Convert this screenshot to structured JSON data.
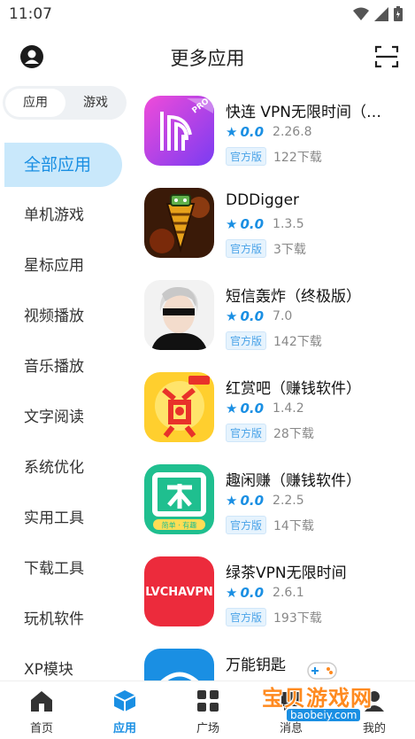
{
  "status": {
    "time": "11:07"
  },
  "header": {
    "title": "更多应用"
  },
  "segment": {
    "apps": "应用",
    "games": "游戏"
  },
  "sidebar": {
    "items": [
      {
        "label": "全部应用",
        "active": true
      },
      {
        "label": "单机游戏"
      },
      {
        "label": "星标应用"
      },
      {
        "label": "视频播放"
      },
      {
        "label": "音乐播放"
      },
      {
        "label": "文字阅读"
      },
      {
        "label": "系统优化"
      },
      {
        "label": "实用工具"
      },
      {
        "label": "下载工具"
      },
      {
        "label": "玩机软件"
      },
      {
        "label": "XP模块"
      }
    ]
  },
  "apps": [
    {
      "name": "快连 VPN无限时间（…",
      "rating": "0.0",
      "version": "2.26.8",
      "badge": "官方版",
      "downloads": "122下载",
      "icon": "letsvpn-icon"
    },
    {
      "name": "DDDigger",
      "rating": "0.0",
      "version": "1.3.5",
      "badge": "官方版",
      "downloads": "3下载",
      "icon": "dddigger-icon"
    },
    {
      "name": "短信轰炸（终极版）",
      "rating": "0.0",
      "version": "7.0",
      "badge": "官方版",
      "downloads": "142下载",
      "icon": "sms-bomb-icon"
    },
    {
      "name": "红赏吧（赚钱软件）",
      "rating": "0.0",
      "version": "1.4.2",
      "badge": "官方版",
      "downloads": "28下载",
      "icon": "hongshangba-icon"
    },
    {
      "name": "趣闲赚（赚钱软件）",
      "rating": "0.0",
      "version": "2.2.5",
      "badge": "官方版",
      "downloads": "14下载",
      "icon": "quxianzhuan-icon",
      "icon_text": "简单 · 有趣"
    },
    {
      "name": "绿茶VPN无限时间",
      "rating": "0.0",
      "version": "2.6.1",
      "badge": "官方版",
      "downloads": "193下载",
      "icon": "lvcha-vpn-icon",
      "icon_text": "LVCHAVPN"
    },
    {
      "name": "万能钥匙",
      "icon": "wifi-key-icon"
    }
  ],
  "pro_label": "PRO",
  "tabs": [
    {
      "label": "首页",
      "icon": "home-icon"
    },
    {
      "label": "应用",
      "icon": "cube-icon",
      "active": true
    },
    {
      "label": "广场",
      "icon": "grid-icon"
    },
    {
      "label": "消息",
      "icon": "message-icon"
    },
    {
      "label": "我的",
      "icon": "profile-icon"
    }
  ],
  "watermark": {
    "text": "宝贝游戏网",
    "url": "baobeiy.com"
  },
  "colors": {
    "accent": "#1a8fe3",
    "active_bg": "#c9e8fb"
  }
}
